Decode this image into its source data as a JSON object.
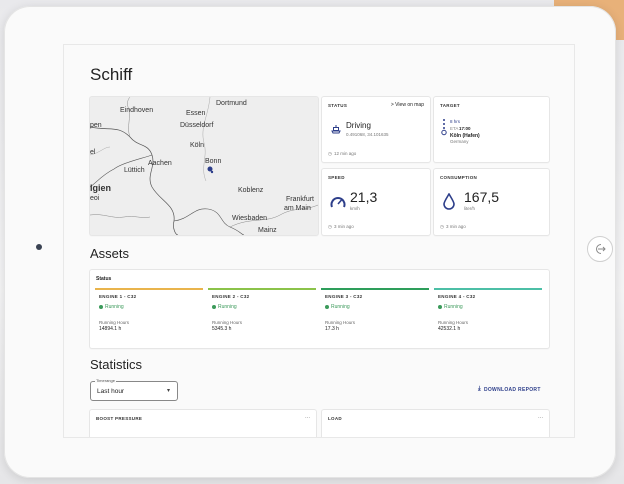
{
  "page": {
    "title": "Schiff"
  },
  "map": {
    "labels": [
      {
        "text": "Eindhoven",
        "big": false
      },
      {
        "text": "Dortmund",
        "big": false
      },
      {
        "text": "Essen",
        "big": false
      },
      {
        "text": "pen",
        "big": false
      },
      {
        "text": "Düsseldorf",
        "big": false
      },
      {
        "text": "Köln",
        "big": false
      },
      {
        "text": "el",
        "big": false
      },
      {
        "text": "Aachen",
        "big": false
      },
      {
        "text": "Bonn",
        "big": false
      },
      {
        "text": "Lüttich",
        "big": false
      },
      {
        "text": "lgien",
        "big": true
      },
      {
        "text": "eoi",
        "big": false
      },
      {
        "text": "Koblenz",
        "big": false
      },
      {
        "text": "Frankfurt",
        "big": false
      },
      {
        "text": "am Main",
        "big": false
      },
      {
        "text": "Wiesbaden",
        "big": false
      },
      {
        "text": "Mainz",
        "big": false
      }
    ]
  },
  "status": {
    "label": "STATUS",
    "link": "> View on map",
    "state": "Driving",
    "coords": "0.491068, 34.101635",
    "updated": "12 min ago"
  },
  "target": {
    "label": "TARGET",
    "distance": "8 hrs",
    "eta_label": "ETA",
    "eta_time": "17:00",
    "destination": "Köln (Hafen)",
    "country": "Germany"
  },
  "speed": {
    "label": "SPEED",
    "value": "21,3",
    "unit": "km/h",
    "updated": "3 min ago"
  },
  "consumption": {
    "label": "CONSUMPTION",
    "value": "167,5",
    "unit": "liter/h",
    "updated": "3 min ago"
  },
  "assets": {
    "title": "Assets",
    "status_label": "Status",
    "engines": [
      {
        "name": "ENGINE 1 - C32",
        "state": "Running",
        "hours_label": "Running Hours",
        "hours": "14894.1 h",
        "color": "#e9b44c"
      },
      {
        "name": "ENGINE 2 - C32",
        "state": "Running",
        "hours_label": "Running Hours",
        "hours": "5345.3 h",
        "color": "#8bc34a"
      },
      {
        "name": "ENGINE 3 - C32",
        "state": "Running",
        "hours_label": "Running Hours",
        "hours": "17.3 h",
        "color": "#2e9e5b"
      },
      {
        "name": "ENGINE 4 - C32",
        "state": "Running",
        "hours_label": "Running Hours",
        "hours": "42532.1 h",
        "color": "#4cbfa6"
      }
    ]
  },
  "statistics": {
    "title": "Statistics",
    "timerange_label": "Timerange",
    "timerange_value": "Last hour",
    "download": "DOWNLOAD REPORT",
    "cards": [
      {
        "label": "BOOST PRESSURE",
        "menu": "···"
      },
      {
        "label": "LOAD",
        "menu": "···"
      }
    ]
  },
  "colors": {
    "accent": "#2d3e8a",
    "running": "#3b9a5a"
  }
}
